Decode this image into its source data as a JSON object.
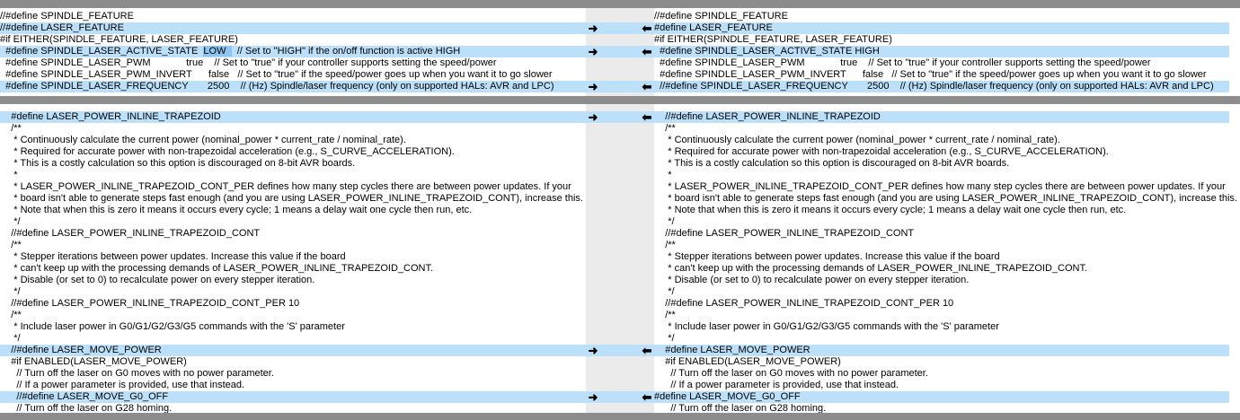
{
  "colors": {
    "diff_bg": "#bde0fa",
    "gutter_bg": "#ebebeb",
    "separator": "#8c8c8c"
  },
  "gutter": {
    "right_arrow_glyph": "➜",
    "left_arrow_glyph": "⬅"
  },
  "left": {
    "top": [
      {
        "text": "//#define SPINDLE_FEATURE",
        "diff": false
      },
      {
        "text": "//#define LASER_FEATURE",
        "diff": true
      },
      {
        "text": "#if EITHER(SPINDLE_FEATURE, LASER_FEATURE)",
        "diff": false
      },
      {
        "pre": "  #define SPINDLE_LASER_ACTIVE_STATE  ",
        "hl": "LOW  ",
        "post": "  // Set to \"HIGH\" if the on/off function is active HIGH",
        "diff": true
      },
      {
        "text": "  #define SPINDLE_LASER_PWM             true    // Set to \"true\" if your controller supports setting the speed/power",
        "diff": false
      },
      {
        "text": "  #define SPINDLE_LASER_PWM_INVERT      false   // Set to \"true\" if the speed/power goes up when you want it to go slower",
        "diff": false
      },
      {
        "text": "  #define SPINDLE_LASER_FREQUENCY       2500    // (Hz) Spindle/laser frequency (only on supported HALs: AVR and LPC)",
        "diff": true
      }
    ],
    "bottom": [
      {
        "text": "    #define LASER_POWER_INLINE_TRAPEZOID",
        "diff": true
      },
      {
        "text": "    /**",
        "diff": false
      },
      {
        "text": "     * Continuously calculate the current power (nominal_power * current_rate / nominal_rate).",
        "diff": false
      },
      {
        "text": "     * Required for accurate power with non-trapezoidal acceleration (e.g., S_CURVE_ACCELERATION).",
        "diff": false
      },
      {
        "text": "     * This is a costly calculation so this option is discouraged on 8-bit AVR boards.",
        "diff": false
      },
      {
        "text": "     *",
        "diff": false
      },
      {
        "text": "     * LASER_POWER_INLINE_TRAPEZOID_CONT_PER defines how many step cycles there are between power updates. If your",
        "diff": false
      },
      {
        "text": "     * board isn't able to generate steps fast enough (and you are using LASER_POWER_INLINE_TRAPEZOID_CONT), increase this.",
        "diff": false
      },
      {
        "text": "     * Note that when this is zero it means it occurs every cycle; 1 means a delay wait one cycle then run, etc.",
        "diff": false
      },
      {
        "text": "     */",
        "diff": false
      },
      {
        "text": "    //#define LASER_POWER_INLINE_TRAPEZOID_CONT",
        "diff": false
      },
      {
        "text": "    /**",
        "diff": false
      },
      {
        "text": "     * Stepper iterations between power updates. Increase this value if the board",
        "diff": false
      },
      {
        "text": "     * can't keep up with the processing demands of LASER_POWER_INLINE_TRAPEZOID_CONT.",
        "diff": false
      },
      {
        "text": "     * Disable (or set to 0) to recalculate power on every stepper iteration.",
        "diff": false
      },
      {
        "text": "     */",
        "diff": false
      },
      {
        "text": "    //#define LASER_POWER_INLINE_TRAPEZOID_CONT_PER 10",
        "diff": false
      },
      {
        "text": "    /**",
        "diff": false
      },
      {
        "text": "     * Include laser power in G0/G1/G2/G3/G5 commands with the 'S' parameter",
        "diff": false
      },
      {
        "text": "     */",
        "diff": false
      },
      {
        "text": "    //#define LASER_MOVE_POWER",
        "diff": true
      },
      {
        "text": "    #if ENABLED(LASER_MOVE_POWER)",
        "diff": false
      },
      {
        "text": "      // Turn off the laser on G0 moves with no power parameter.",
        "diff": false
      },
      {
        "text": "      // If a power parameter is provided, use that instead.",
        "diff": false
      },
      {
        "text": "      //#define LASER_MOVE_G0_OFF",
        "diff": true
      },
      {
        "text": "      // Turn off the laser on G28 homing.",
        "diff": false
      }
    ]
  },
  "right": {
    "top": [
      {
        "text": "//#define SPINDLE_FEATURE",
        "diff": false
      },
      {
        "text": "#define LASER_FEATURE",
        "diff": true
      },
      {
        "text": "#if EITHER(SPINDLE_FEATURE, LASER_FEATURE)",
        "diff": false
      },
      {
        "text": "  #define SPINDLE_LASER_ACTIVE_STATE HIGH",
        "diff": true
      },
      {
        "text": "  #define SPINDLE_LASER_PWM             true    // Set to \"true\" if your controller supports setting the speed/power",
        "diff": false
      },
      {
        "text": "  #define SPINDLE_LASER_PWM_INVERT      false   // Set to \"true\" if the speed/power goes up when you want it to go slower",
        "diff": false
      },
      {
        "text": "  //#define SPINDLE_LASER_FREQUENCY       2500    // (Hz) Spindle/laser frequency (only on supported HALs: AVR and LPC)",
        "diff": true
      }
    ],
    "bottom": [
      {
        "text": "    //#define LASER_POWER_INLINE_TRAPEZOID",
        "diff": true
      },
      {
        "text": "    /**",
        "diff": false
      },
      {
        "text": "     * Continuously calculate the current power (nominal_power * current_rate / nominal_rate).",
        "diff": false
      },
      {
        "text": "     * Required for accurate power with non-trapezoidal acceleration (e.g., S_CURVE_ACCELERATION).",
        "diff": false
      },
      {
        "text": "     * This is a costly calculation so this option is discouraged on 8-bit AVR boards.",
        "diff": false
      },
      {
        "text": "     *",
        "diff": false
      },
      {
        "text": "     * LASER_POWER_INLINE_TRAPEZOID_CONT_PER defines how many step cycles there are between power updates. If your",
        "diff": false
      },
      {
        "text": "     * board isn't able to generate steps fast enough (and you are using LASER_POWER_INLINE_TRAPEZOID_CONT), increase this.",
        "diff": false
      },
      {
        "text": "     * Note that when this is zero it means it occurs every cycle; 1 means a delay wait one cycle then run, etc.",
        "diff": false
      },
      {
        "text": "     */",
        "diff": false
      },
      {
        "text": "    //#define LASER_POWER_INLINE_TRAPEZOID_CONT",
        "diff": false
      },
      {
        "text": "    /**",
        "diff": false
      },
      {
        "text": "     * Stepper iterations between power updates. Increase this value if the board",
        "diff": false
      },
      {
        "text": "     * can't keep up with the processing demands of LASER_POWER_INLINE_TRAPEZOID_CONT.",
        "diff": false
      },
      {
        "text": "     * Disable (or set to 0) to recalculate power on every stepper iteration.",
        "diff": false
      },
      {
        "text": "     */",
        "diff": false
      },
      {
        "text": "    //#define LASER_POWER_INLINE_TRAPEZOID_CONT_PER 10",
        "diff": false
      },
      {
        "text": "    /**",
        "diff": false
      },
      {
        "text": "     * Include laser power in G0/G1/G2/G3/G5 commands with the 'S' parameter",
        "diff": false
      },
      {
        "text": "     */",
        "diff": false
      },
      {
        "text": "    #define LASER_MOVE_POWER",
        "diff": true
      },
      {
        "text": "    #if ENABLED(LASER_MOVE_POWER)",
        "diff": false
      },
      {
        "text": "      // Turn off the laser on G0 moves with no power parameter.",
        "diff": false
      },
      {
        "text": "      // If a power parameter is provided, use that instead.",
        "diff": false
      },
      {
        "text": "#define LASER_MOVE_G0_OFF",
        "diff": true
      },
      {
        "text": "      // Turn off the laser on G28 homing.",
        "diff": false
      }
    ]
  }
}
